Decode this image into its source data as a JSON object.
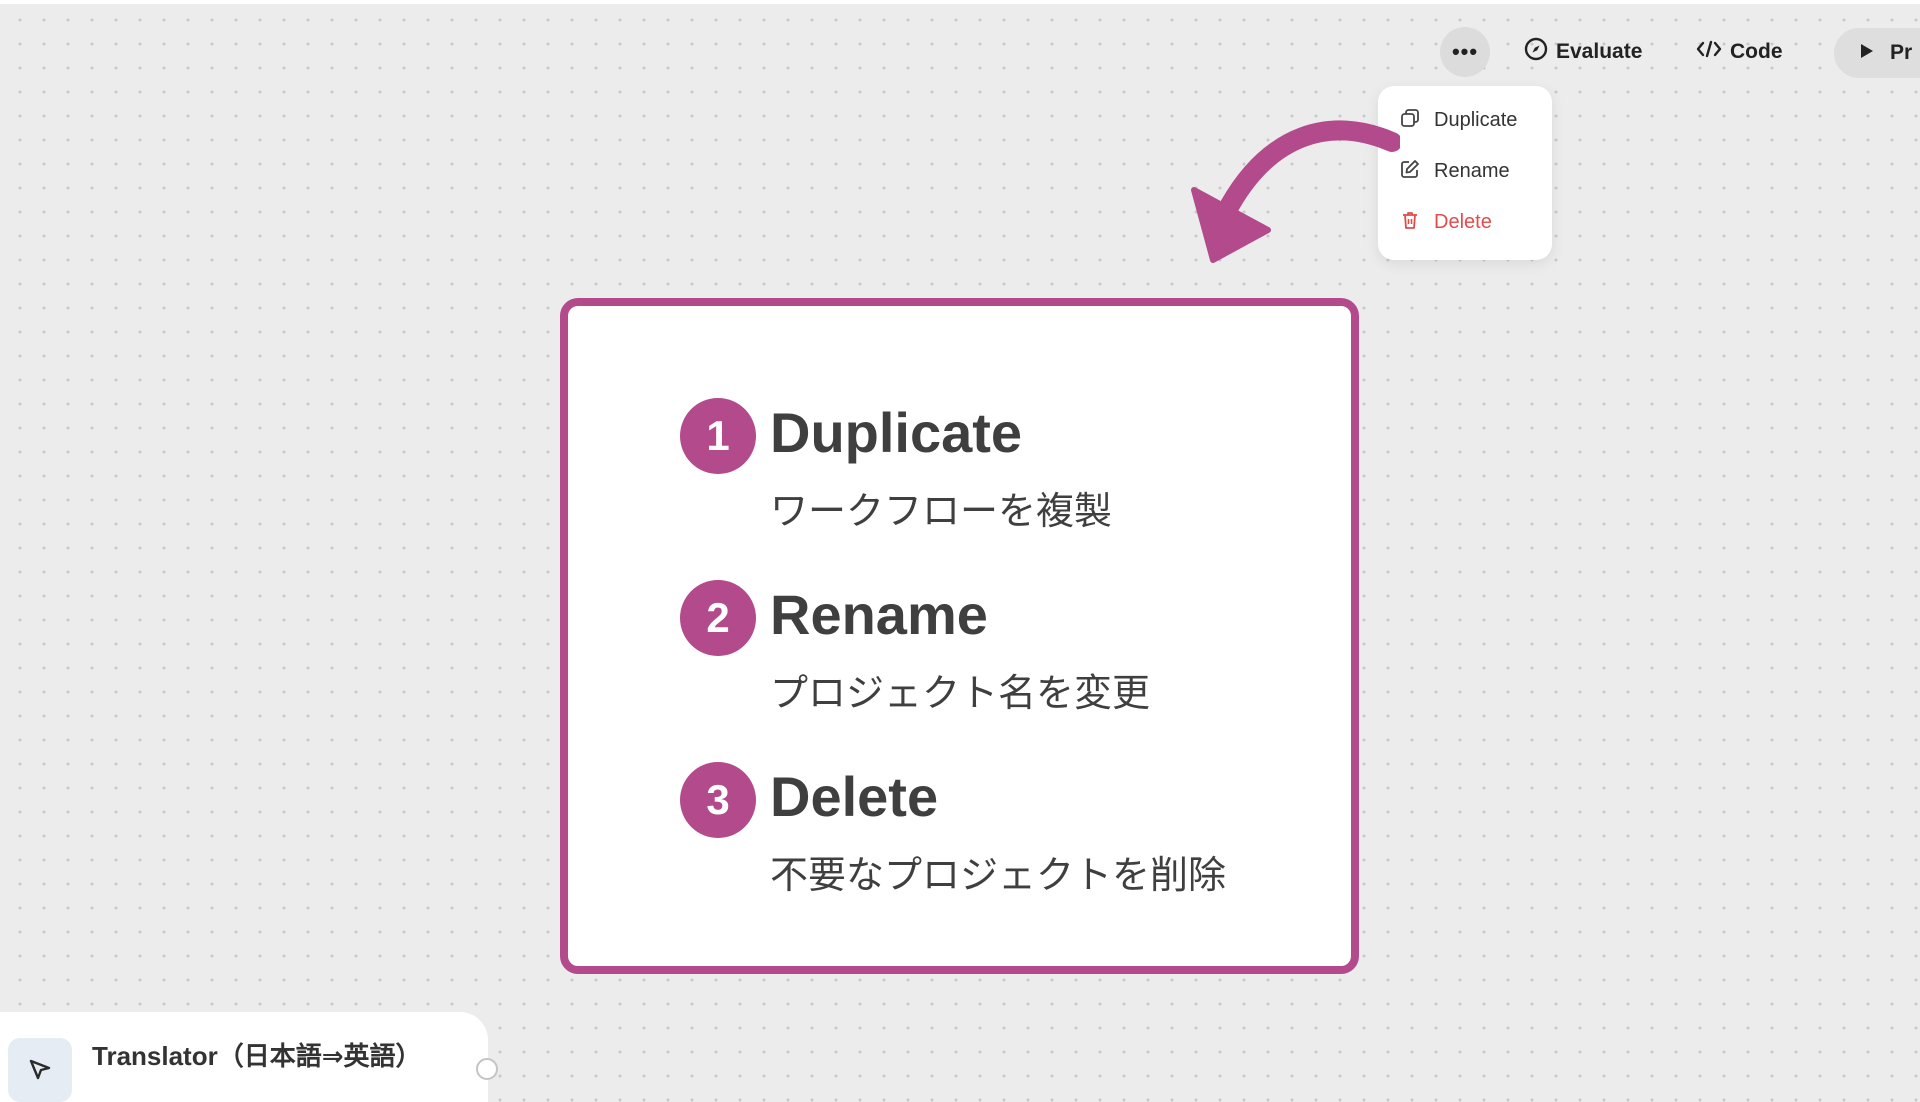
{
  "toolbar": {
    "more_label": "•••",
    "evaluate_label": "Evaluate",
    "code_label": "Code",
    "preview_label": "Pr"
  },
  "menu": {
    "items": [
      {
        "label": "Duplicate",
        "icon": "copy-icon"
      },
      {
        "label": "Rename",
        "icon": "edit-icon"
      },
      {
        "label": "Delete",
        "icon": "trash-icon"
      }
    ]
  },
  "callout": {
    "steps": [
      {
        "number": "1",
        "title": "Duplicate",
        "description": "ワークフローを複製"
      },
      {
        "number": "2",
        "title": "Rename",
        "description": "プロジェクト名を変更"
      },
      {
        "number": "3",
        "title": "Delete",
        "description": "不要なプロジェクトを削除"
      }
    ]
  },
  "node": {
    "title": "Translator（日本語⇒英語）",
    "icon": "cursor-icon"
  },
  "colors": {
    "accent": "#b24a8b",
    "delete": "#e24c4c",
    "canvas": "#ececec"
  }
}
